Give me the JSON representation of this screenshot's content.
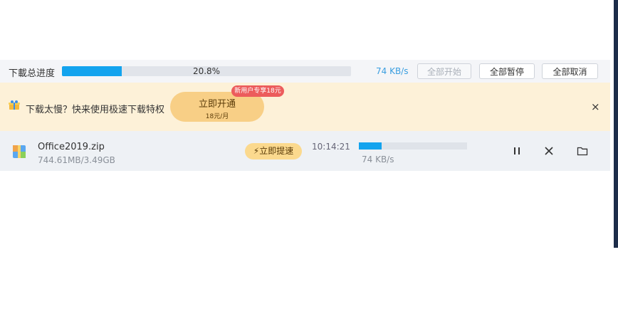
{
  "summary": {
    "label": "下載总进度",
    "progress": 0.208,
    "progress_text": "20.8%",
    "speed": "74 KB/s",
    "buttons": {
      "start_all": "全部开始",
      "pause_all": "全部暂停",
      "cancel_all": "全部取消"
    }
  },
  "promo": {
    "text": "下载太慢？快来使用极速下载特权",
    "cta_line1": "立即开通",
    "cta_line2": "18元/月",
    "tag": "新用户专享18元",
    "close": "×",
    "accent_color": "#f8cf86",
    "tag_color": "#ec5c5c"
  },
  "download": {
    "name": "Office2019.zip",
    "size": "744.61MB/3.49GB",
    "speedup": "⚡立即提速",
    "time": "10:14:21",
    "progress": 0.208,
    "speed": "74 KB/s",
    "actions": {
      "pause": "⏸",
      "cancel": "✕",
      "open_folder": "folder-icon"
    }
  },
  "colors": {
    "progress_blue": "#13a3ee",
    "row_bg": "#eef1f5",
    "banner_bg": "#fdf1d8"
  }
}
